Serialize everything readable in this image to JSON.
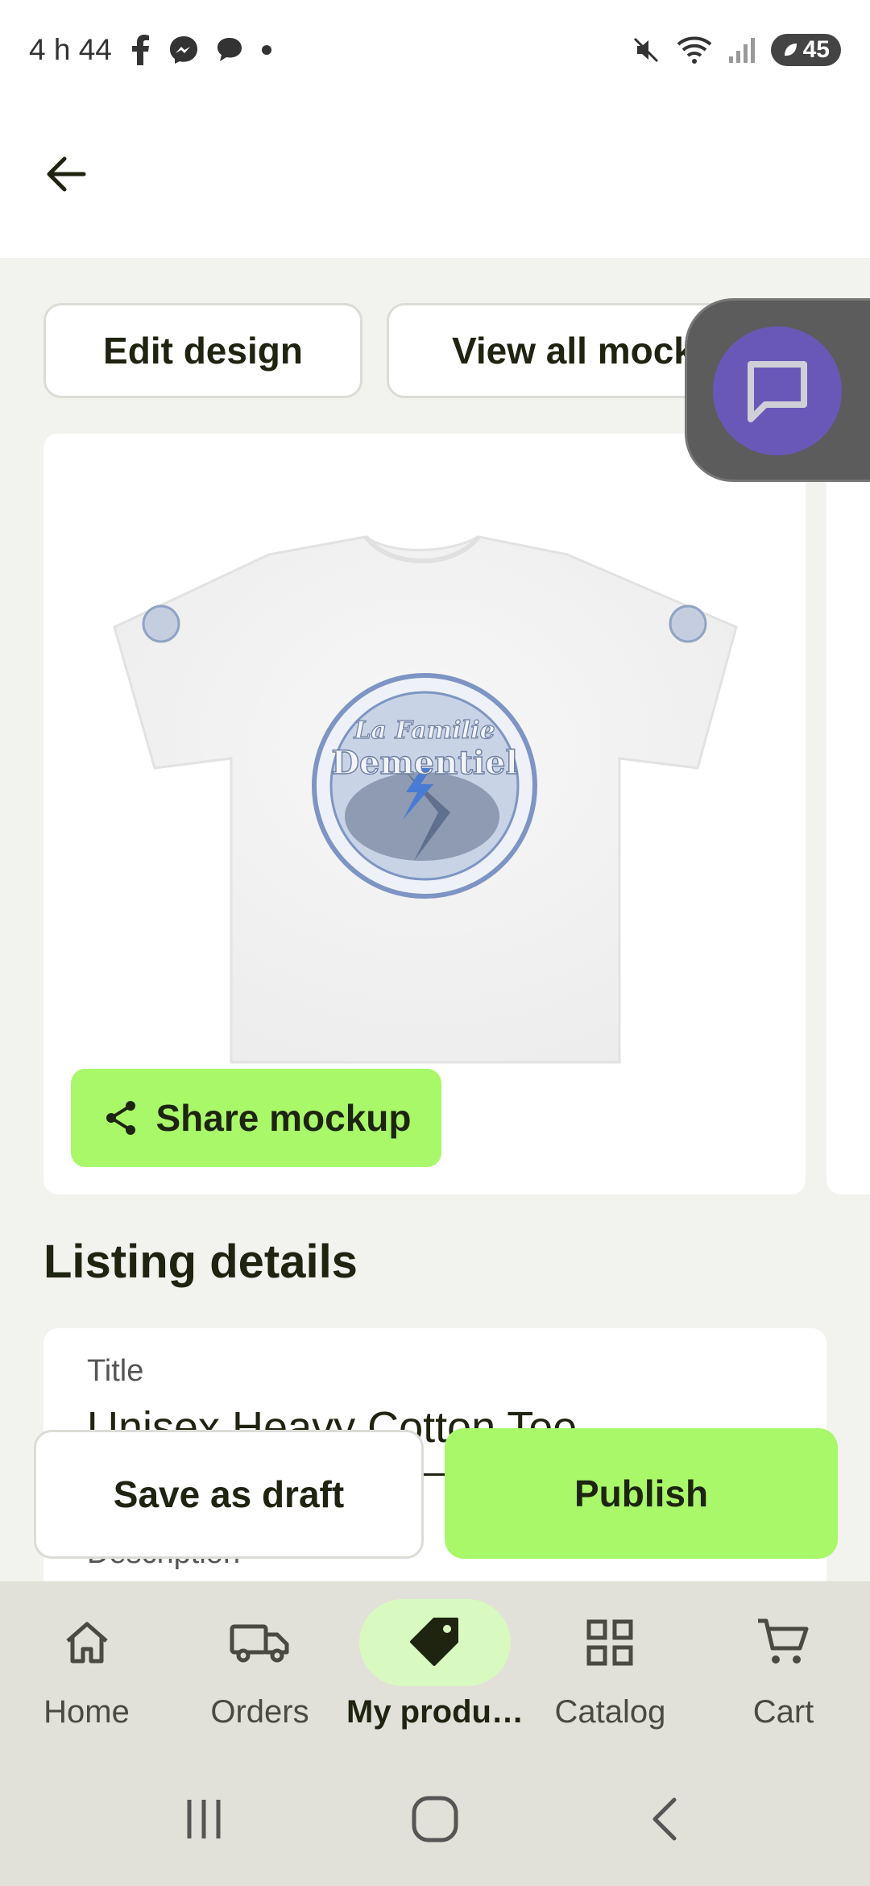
{
  "status_bar": {
    "time": "4 h 44",
    "battery_level": "45"
  },
  "actions": {
    "edit_design": "Edit design",
    "view_all_mockups": "View all mock"
  },
  "mockup": {
    "share_label": "Share mockup",
    "design_text_line1": "La Familie",
    "design_text_line2": "Dementiel"
  },
  "listing": {
    "section_title": "Listing details",
    "title_label": "Title",
    "title_value": "Unisex Heavy Cotton Tee",
    "description_label": "Description"
  },
  "footer_actions": {
    "save_draft": "Save as draft",
    "publish": "Publish"
  },
  "bottom_nav": {
    "items": [
      {
        "label": "Home",
        "icon": "home-icon",
        "active": false
      },
      {
        "label": "Orders",
        "icon": "truck-icon",
        "active": false
      },
      {
        "label": "My produ…",
        "icon": "tag-icon",
        "active": true
      },
      {
        "label": "Catalog",
        "icon": "grid-icon",
        "active": false
      },
      {
        "label": "Cart",
        "icon": "cart-icon",
        "active": false
      }
    ]
  },
  "colors": {
    "accent_green": "#a8f86a",
    "chat_purple": "#6a58b8",
    "text_dark": "#1f2410"
  }
}
